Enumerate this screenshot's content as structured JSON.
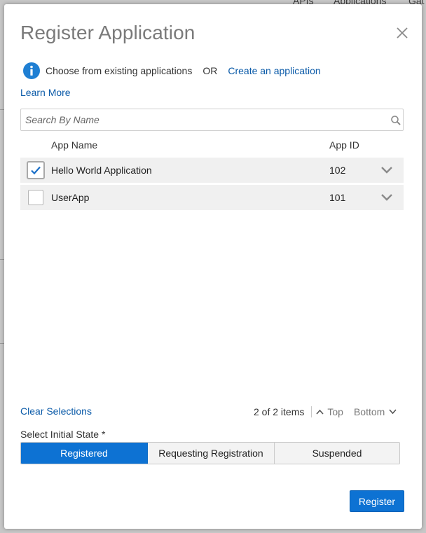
{
  "background": {
    "tabs": [
      "APIs",
      "Applications",
      "Gat"
    ]
  },
  "dialog": {
    "title": "Register Application",
    "info": {
      "text": "Choose from existing applications",
      "or": "OR",
      "create_link": "Create an application"
    },
    "learn_more": "Learn More",
    "search": {
      "placeholder": "Search By Name",
      "value": ""
    },
    "table": {
      "columns": [
        "App Name",
        "App ID"
      ],
      "rows": [
        {
          "name": "Hello World Application",
          "id": "102",
          "checked": true
        },
        {
          "name": "UserApp",
          "id": "101",
          "checked": false
        }
      ]
    },
    "clear_selections": "Clear Selections",
    "pager": {
      "count": "2 of 2 items",
      "top": "Top",
      "bottom": "Bottom"
    },
    "initial_state": {
      "label": "Select Initial State *",
      "options": [
        "Registered",
        "Requesting Registration",
        "Suspended"
      ],
      "selected": "Registered"
    },
    "register_button": "Register"
  },
  "colors": {
    "accent": "#0d72d3",
    "link": "#0a5aa8",
    "row_bg": "#f0f0f0"
  }
}
